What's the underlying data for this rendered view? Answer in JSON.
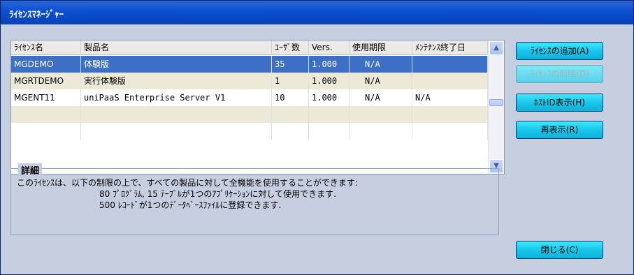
{
  "window": {
    "title": "ﾗｲｾﾝｽﾏﾈｰｼﾞｬｰ"
  },
  "list": {
    "columns": [
      "ﾗｲｾﾝｽ名",
      "製品名",
      "ﾕｰｻﾞ数",
      "Vers.",
      "使用期限",
      "ﾒﾝﾃﾅﾝｽ終了日"
    ],
    "rows": [
      {
        "license": "MGDEMO",
        "product": "体験版",
        "users": "35",
        "version": "1.000",
        "expiry": "N/A",
        "maintenance": ""
      },
      {
        "license": "MGRTDEMO",
        "product": "実行体験版",
        "users": "1",
        "version": "1.000",
        "expiry": "N/A",
        "maintenance": ""
      },
      {
        "license": "MGENT11",
        "product": "uniPaaS Enterprise Server V1",
        "users": "10",
        "version": "1.000",
        "expiry": "N/A",
        "maintenance": "N/A"
      }
    ],
    "selected_index": 0
  },
  "details": {
    "title": "詳細",
    "line1": "このﾗｲｾﾝｽは、以下の制限の上で、すべての製品に対して全機能を使用することができます:",
    "line2": "80 ﾌﾟﾛｸﾞﾗﾑ, 15 ﾃｰﾌﾞﾙが1つのｱﾌﾟﾘｹｰｼｮﾝに対して使用できます.",
    "line3": "500 ﾚｺｰﾄﾞが1つのﾃﾞｰﾀﾍﾞｰｽﾌｧｲﾙに登録できます."
  },
  "buttons": {
    "add": "ﾗｲｾﾝｽの追加(A)",
    "delete": "ﾗｲｾﾝｽの削除(D)",
    "hostid": "ﾎｽﾄID表示(H)",
    "refresh": "再表示(R)",
    "close": "閉じる(C)"
  },
  "icons": {
    "scroll_up": "chevron-up-icon",
    "scroll_down": "chevron-down-icon"
  },
  "colors": {
    "titlebar": "#0a4fd0",
    "selected_row": "#3d6fc6",
    "button": "#19c6ea",
    "background": "#c6cfdf"
  }
}
